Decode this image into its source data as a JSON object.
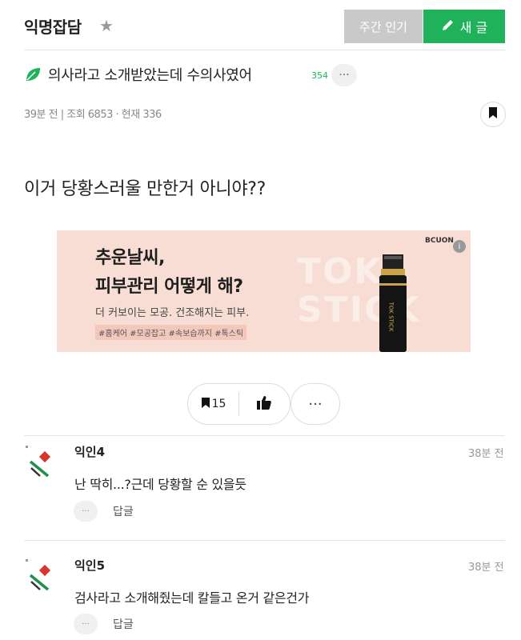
{
  "header": {
    "board_title": "익명잡담",
    "star_icon": "star-icon",
    "weekly_label": "주간 인기",
    "write_label": "새 글",
    "accent": "#1fb25a"
  },
  "post": {
    "title": "의사라고 소개받았는데 수의사였어",
    "comment_count": "354",
    "more": "···",
    "meta": "39분 전  |  조회 6853 · 현재 336",
    "body": "이거 당황스러울 만한거 아니야??"
  },
  "ad": {
    "line1": "추운날씨,",
    "line2": "피부관리 어떻게 해?",
    "desc": "더 커보이는 모공. 건조해지는 피부.",
    "tags": "#홈케어 #모공잡고 #속보습까지 #톡스틱",
    "brand": "BCUON",
    "background_text": "TOK STICK",
    "product_label": "TOK STICK"
  },
  "actions": {
    "bookmark_count": "15",
    "more": "···"
  },
  "comments": [
    {
      "author": "익인4",
      "time": "38분 전",
      "text": "난 딱히...?근데 당황할 순 있을듯",
      "more": "···",
      "reply": "답글"
    },
    {
      "author": "익인5",
      "time": "38분 전",
      "text": "검사라고 소개해줬는데 칼들고 온거 같은건가",
      "more": "···",
      "reply": "답글"
    }
  ]
}
